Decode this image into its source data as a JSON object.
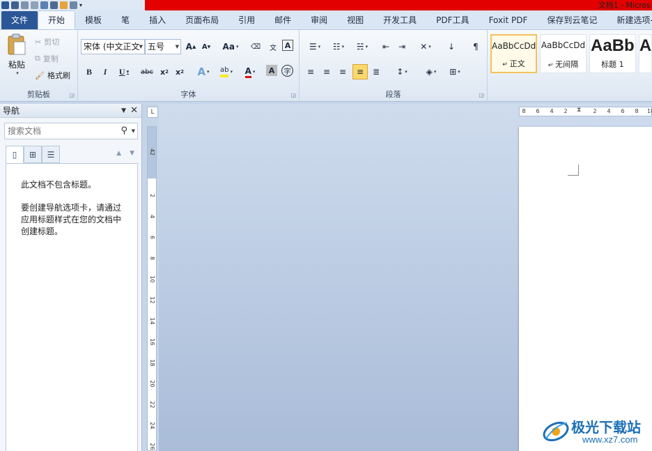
{
  "window": {
    "title": "文档1 - Micros"
  },
  "ribbon_tabs": [
    "文件",
    "开始",
    "模板",
    "笔",
    "插入",
    "页面布局",
    "引用",
    "邮件",
    "审阅",
    "视图",
    "开发工具",
    "PDF工具",
    "Foxit PDF",
    "保存到云笔记",
    "新建选项-"
  ],
  "active_tab": "开始",
  "clipboard": {
    "paste": "粘贴",
    "cut": "剪切",
    "copy": "复制",
    "format_painter": "格式刷",
    "label": "剪贴板"
  },
  "font": {
    "font_name": "宋体 (中文正文",
    "font_size": "五号",
    "label": "字体"
  },
  "paragraph": {
    "label": "段落"
  },
  "styles": [
    {
      "preview": "AaBbCcDd",
      "name": "正文",
      "selected": true
    },
    {
      "preview": "AaBbCcDd",
      "name": "无间隔",
      "selected": false
    },
    {
      "preview": "AaBb",
      "name": "标题 1",
      "selected": false
    },
    {
      "preview": "A",
      "name": "",
      "selected": false
    }
  ],
  "nav_pane": {
    "title": "导航",
    "search_placeholder": "搜索文档",
    "message1": "此文档不包含标题。",
    "message2": "要创建导航选项卡，请通过应用标题样式在您的文档中创建标题。"
  },
  "ruler": {
    "vertical": [
      "4",
      "2",
      "",
      "2",
      "4",
      "6",
      "8",
      "10",
      "12",
      "14",
      "16",
      "18",
      "20",
      "22",
      "24",
      "26"
    ],
    "horizontal": [
      "8",
      "6",
      "4",
      "2",
      "",
      "2",
      "4",
      "6",
      "8",
      "10"
    ]
  },
  "watermark": {
    "name": "极光下载站",
    "url": "www.xz7.com"
  },
  "colors": {
    "file_tab": "#2b5797",
    "titlebar": "#e30000",
    "accent": "#f3c25b"
  }
}
